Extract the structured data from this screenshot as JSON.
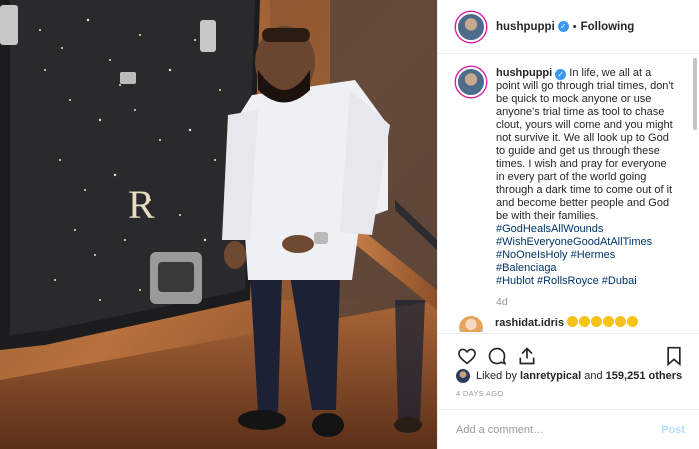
{
  "post": {
    "username": "hushpuppi",
    "follow_status": "Following",
    "dot": "•",
    "verified_mark": "✓"
  },
  "caption": {
    "username": "hushpuppi",
    "text": " In life, we all at a point will go through trial times, don't be quick to mock anyone or use anyone's trial time as tool to chase clout, yours will come and you might not survive it. We all look up to God to guide and get us through these times. I wish and pray for everyone in every part of the world going through a dark time to come out of it and become better people and God be with their families.",
    "hashtags": [
      "#GodHealsAllWounds",
      "#WishEveryoneGoodAtAllTimes",
      "#NoOneIsHoly",
      "#Hermes",
      "#Balenciaga",
      "#Hublot",
      "#RollsRoyce",
      "#Dubai"
    ],
    "age": "4d"
  },
  "reply": {
    "username": "rashidat.idris",
    "hearts": "❤❤❤❤❤❤",
    "like_icon": "♡"
  },
  "likes": {
    "prefix": "Liked by ",
    "user": "lanretypical",
    "middle": " and ",
    "count": "159,251 others"
  },
  "timestamp": "4 DAYS AGO",
  "comment_box": {
    "placeholder": "Add a comment…",
    "post_label": "Post"
  },
  "icons": {
    "like": "heart-outline-icon",
    "comment": "comment-bubble-icon",
    "share": "share-arrow-icon",
    "save": "bookmark-icon"
  },
  "colors": {
    "link": "#003569",
    "verified": "#3897f0",
    "heart": "#e0245e",
    "post_disabled": "#b2dffc",
    "muted": "#999999"
  }
}
